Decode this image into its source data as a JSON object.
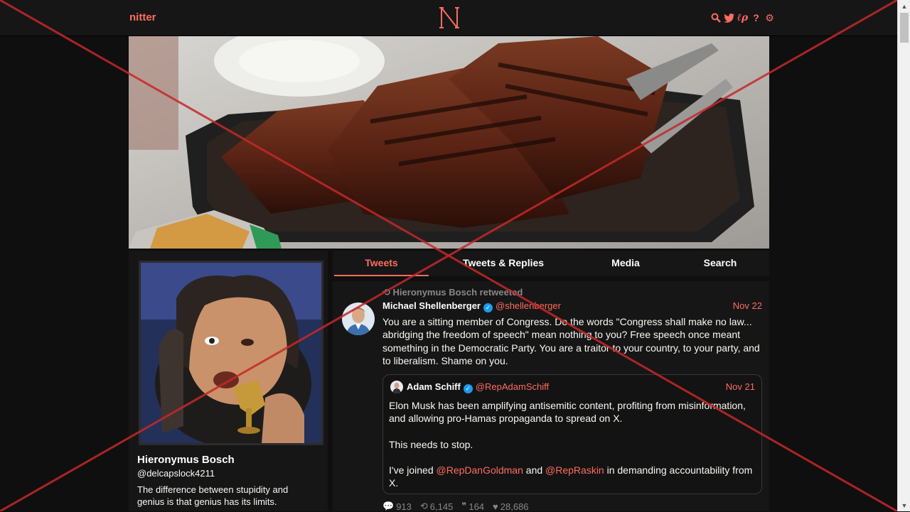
{
  "navbar": {
    "brand": "nitter",
    "icons": [
      "search-icon",
      "twitter-bird-icon",
      "rss-icon",
      "info-icon",
      "gear-icon"
    ],
    "accent_color": "#ff6c60"
  },
  "profile": {
    "fullname": "Hieronymus Bosch",
    "username": "@delcapslock4211",
    "bio": "The difference between stupidity and genius is that genius has its limits."
  },
  "tabs": [
    "Tweets",
    "Tweets & Replies",
    "Media",
    "Search"
  ],
  "tweet": {
    "retweet_header": "Hieronymus Bosch retweeted",
    "author_name": "Michael Shellenberger",
    "author_handle": "@shellenberger",
    "date": "Nov 22",
    "body": "You are a sitting member of Congress. Do the words \"Congress shall make no law... abridging the freedom of speech\" mean nothing to you? Free speech once meant something in the Democratic Party. You are a traitor to your country, to your party, and to liberalism. Shame on you.",
    "quote": {
      "author_name": "Adam Schiff",
      "author_handle": "@RepAdamSchiff",
      "date": "Nov 21",
      "paragraph_1": "Elon Musk has been amplifying antisemitic content, profiting from misinformation, and allowing pro-Hamas propaganda to spread on X.",
      "paragraph_2": "This needs to stop.",
      "paragraph_3_before": "I've joined ",
      "mention_1": "@RepDanGoldman",
      "paragraph_3_middle": " and ",
      "mention_2": "@RepRaskin",
      "paragraph_3_after": " in demanding accountability from X."
    },
    "stats": {
      "replies": "913",
      "retweets": "6,145",
      "quotes": "164",
      "likes": "28,686"
    }
  }
}
